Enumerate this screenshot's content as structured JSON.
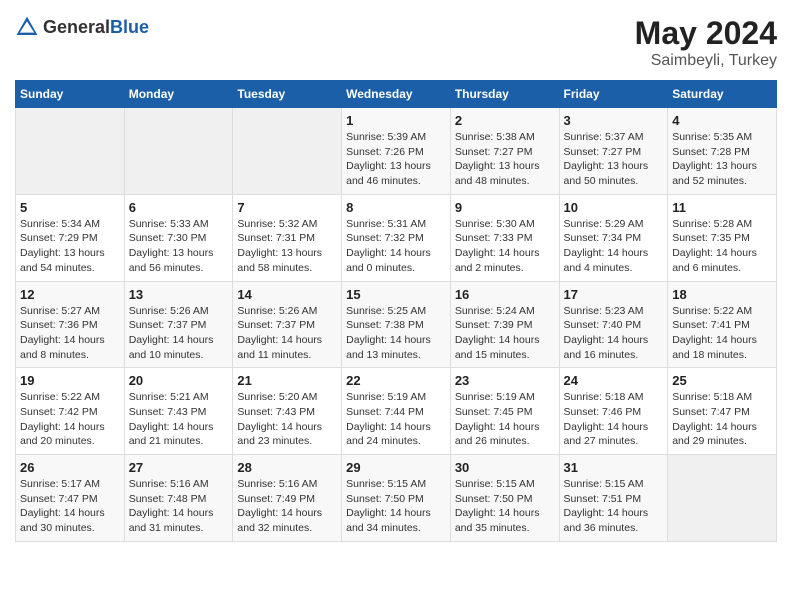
{
  "header": {
    "logo": {
      "text_general": "General",
      "text_blue": "Blue"
    },
    "title": "May 2024",
    "location": "Saimbeyli, Turkey"
  },
  "days_of_week": [
    "Sunday",
    "Monday",
    "Tuesday",
    "Wednesday",
    "Thursday",
    "Friday",
    "Saturday"
  ],
  "weeks": [
    [
      {
        "day": "",
        "content": ""
      },
      {
        "day": "",
        "content": ""
      },
      {
        "day": "",
        "content": ""
      },
      {
        "day": "1",
        "content": "Sunrise: 5:39 AM\nSunset: 7:26 PM\nDaylight: 13 hours\nand 46 minutes."
      },
      {
        "day": "2",
        "content": "Sunrise: 5:38 AM\nSunset: 7:27 PM\nDaylight: 13 hours\nand 48 minutes."
      },
      {
        "day": "3",
        "content": "Sunrise: 5:37 AM\nSunset: 7:27 PM\nDaylight: 13 hours\nand 50 minutes."
      },
      {
        "day": "4",
        "content": "Sunrise: 5:35 AM\nSunset: 7:28 PM\nDaylight: 13 hours\nand 52 minutes."
      }
    ],
    [
      {
        "day": "5",
        "content": "Sunrise: 5:34 AM\nSunset: 7:29 PM\nDaylight: 13 hours\nand 54 minutes."
      },
      {
        "day": "6",
        "content": "Sunrise: 5:33 AM\nSunset: 7:30 PM\nDaylight: 13 hours\nand 56 minutes."
      },
      {
        "day": "7",
        "content": "Sunrise: 5:32 AM\nSunset: 7:31 PM\nDaylight: 13 hours\nand 58 minutes."
      },
      {
        "day": "8",
        "content": "Sunrise: 5:31 AM\nSunset: 7:32 PM\nDaylight: 14 hours\nand 0 minutes."
      },
      {
        "day": "9",
        "content": "Sunrise: 5:30 AM\nSunset: 7:33 PM\nDaylight: 14 hours\nand 2 minutes."
      },
      {
        "day": "10",
        "content": "Sunrise: 5:29 AM\nSunset: 7:34 PM\nDaylight: 14 hours\nand 4 minutes."
      },
      {
        "day": "11",
        "content": "Sunrise: 5:28 AM\nSunset: 7:35 PM\nDaylight: 14 hours\nand 6 minutes."
      }
    ],
    [
      {
        "day": "12",
        "content": "Sunrise: 5:27 AM\nSunset: 7:36 PM\nDaylight: 14 hours\nand 8 minutes."
      },
      {
        "day": "13",
        "content": "Sunrise: 5:26 AM\nSunset: 7:37 PM\nDaylight: 14 hours\nand 10 minutes."
      },
      {
        "day": "14",
        "content": "Sunrise: 5:26 AM\nSunset: 7:37 PM\nDaylight: 14 hours\nand 11 minutes."
      },
      {
        "day": "15",
        "content": "Sunrise: 5:25 AM\nSunset: 7:38 PM\nDaylight: 14 hours\nand 13 minutes."
      },
      {
        "day": "16",
        "content": "Sunrise: 5:24 AM\nSunset: 7:39 PM\nDaylight: 14 hours\nand 15 minutes."
      },
      {
        "day": "17",
        "content": "Sunrise: 5:23 AM\nSunset: 7:40 PM\nDaylight: 14 hours\nand 16 minutes."
      },
      {
        "day": "18",
        "content": "Sunrise: 5:22 AM\nSunset: 7:41 PM\nDaylight: 14 hours\nand 18 minutes."
      }
    ],
    [
      {
        "day": "19",
        "content": "Sunrise: 5:22 AM\nSunset: 7:42 PM\nDaylight: 14 hours\nand 20 minutes."
      },
      {
        "day": "20",
        "content": "Sunrise: 5:21 AM\nSunset: 7:43 PM\nDaylight: 14 hours\nand 21 minutes."
      },
      {
        "day": "21",
        "content": "Sunrise: 5:20 AM\nSunset: 7:43 PM\nDaylight: 14 hours\nand 23 minutes."
      },
      {
        "day": "22",
        "content": "Sunrise: 5:19 AM\nSunset: 7:44 PM\nDaylight: 14 hours\nand 24 minutes."
      },
      {
        "day": "23",
        "content": "Sunrise: 5:19 AM\nSunset: 7:45 PM\nDaylight: 14 hours\nand 26 minutes."
      },
      {
        "day": "24",
        "content": "Sunrise: 5:18 AM\nSunset: 7:46 PM\nDaylight: 14 hours\nand 27 minutes."
      },
      {
        "day": "25",
        "content": "Sunrise: 5:18 AM\nSunset: 7:47 PM\nDaylight: 14 hours\nand 29 minutes."
      }
    ],
    [
      {
        "day": "26",
        "content": "Sunrise: 5:17 AM\nSunset: 7:47 PM\nDaylight: 14 hours\nand 30 minutes."
      },
      {
        "day": "27",
        "content": "Sunrise: 5:16 AM\nSunset: 7:48 PM\nDaylight: 14 hours\nand 31 minutes."
      },
      {
        "day": "28",
        "content": "Sunrise: 5:16 AM\nSunset: 7:49 PM\nDaylight: 14 hours\nand 32 minutes."
      },
      {
        "day": "29",
        "content": "Sunrise: 5:15 AM\nSunset: 7:50 PM\nDaylight: 14 hours\nand 34 minutes."
      },
      {
        "day": "30",
        "content": "Sunrise: 5:15 AM\nSunset: 7:50 PM\nDaylight: 14 hours\nand 35 minutes."
      },
      {
        "day": "31",
        "content": "Sunrise: 5:15 AM\nSunset: 7:51 PM\nDaylight: 14 hours\nand 36 minutes."
      },
      {
        "day": "",
        "content": ""
      }
    ]
  ]
}
